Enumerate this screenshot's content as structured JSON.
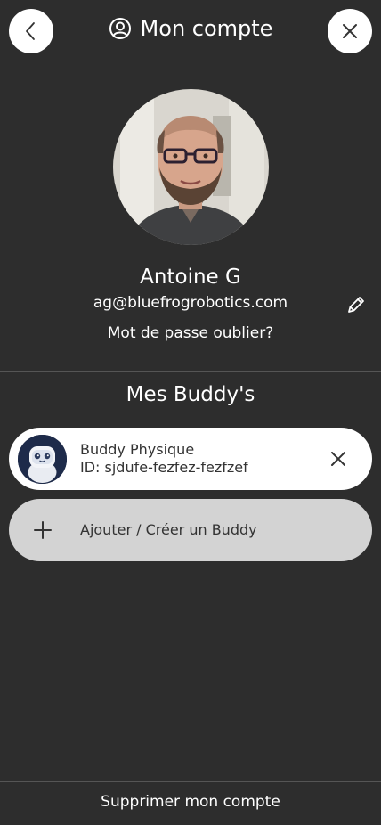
{
  "header": {
    "title": "Mon compte"
  },
  "profile": {
    "name": "Antoine G",
    "email": "ag@bluefrogrobotics.com",
    "forgot_password": "Mot de passe oublier?"
  },
  "buddies": {
    "section_title": "Mes Buddy's",
    "items": [
      {
        "name": "Buddy Physique",
        "id": "ID: sjdufe-fezfez-fezfzef"
      }
    ],
    "add_label": "Ajouter / Créer un Buddy"
  },
  "footer": {
    "delete_account": "Supprimer mon compte"
  },
  "colors": {
    "background": "#2d2d2d",
    "card": "#ffffff",
    "add_button": "#d3d3d3",
    "text_light": "#ffffff",
    "text_dark": "#333333"
  }
}
